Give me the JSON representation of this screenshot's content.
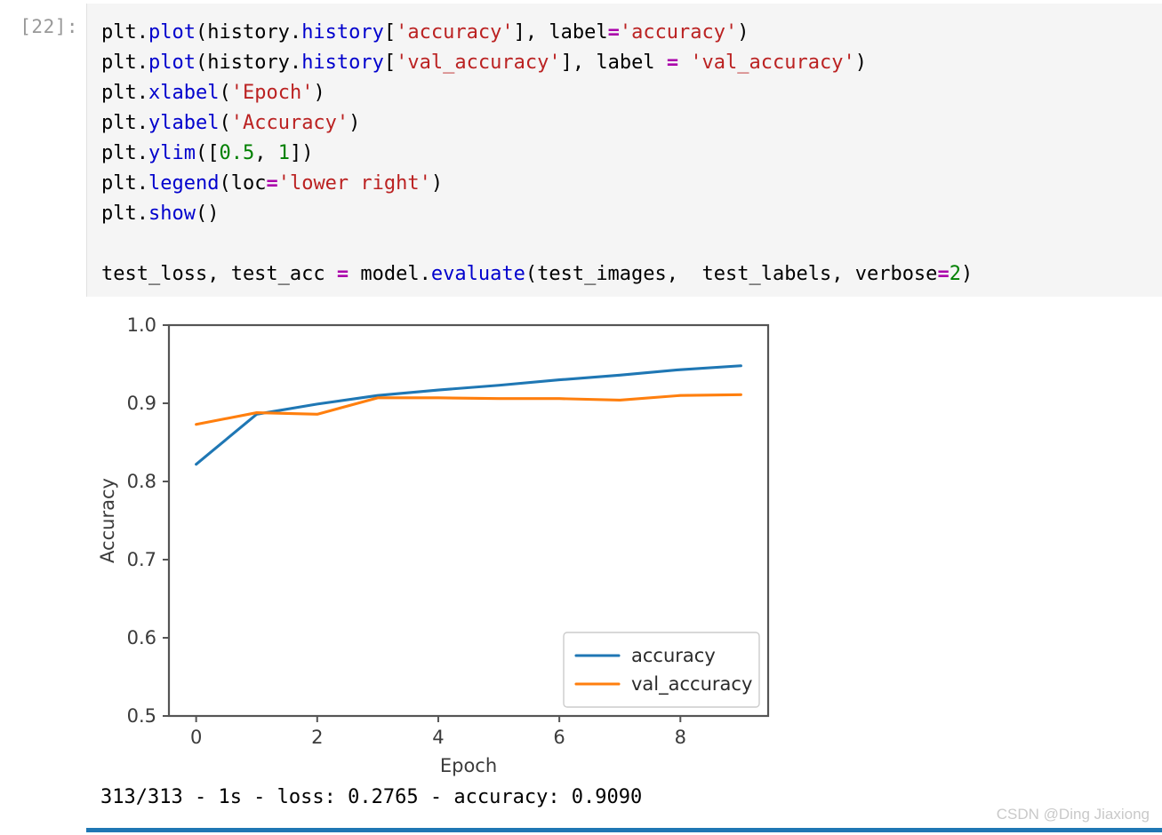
{
  "notebook": {
    "prompt_label": "[22]:",
    "code_lines": [
      [
        {
          "t": "plt.",
          "c": "plain"
        },
        {
          "t": "plot",
          "c": "fn"
        },
        {
          "t": "(history.",
          "c": "plain"
        },
        {
          "t": "history",
          "c": "fn"
        },
        {
          "t": "[",
          "c": "plain"
        },
        {
          "t": "'accuracy'",
          "c": "str"
        },
        {
          "t": "], label",
          "c": "plain"
        },
        {
          "t": "=",
          "c": "op"
        },
        {
          "t": "'accuracy'",
          "c": "str"
        },
        {
          "t": ")",
          "c": "plain"
        }
      ],
      [
        {
          "t": "plt.",
          "c": "plain"
        },
        {
          "t": "plot",
          "c": "fn"
        },
        {
          "t": "(history.",
          "c": "plain"
        },
        {
          "t": "history",
          "c": "fn"
        },
        {
          "t": "[",
          "c": "plain"
        },
        {
          "t": "'val_accuracy'",
          "c": "str"
        },
        {
          "t": "], label ",
          "c": "plain"
        },
        {
          "t": "=",
          "c": "op"
        },
        {
          "t": " ",
          "c": "plain"
        },
        {
          "t": "'val_accuracy'",
          "c": "str"
        },
        {
          "t": ")",
          "c": "plain"
        }
      ],
      [
        {
          "t": "plt.",
          "c": "plain"
        },
        {
          "t": "xlabel",
          "c": "fn"
        },
        {
          "t": "(",
          "c": "plain"
        },
        {
          "t": "'Epoch'",
          "c": "str"
        },
        {
          "t": ")",
          "c": "plain"
        }
      ],
      [
        {
          "t": "plt.",
          "c": "plain"
        },
        {
          "t": "ylabel",
          "c": "fn"
        },
        {
          "t": "(",
          "c": "plain"
        },
        {
          "t": "'Accuracy'",
          "c": "str"
        },
        {
          "t": ")",
          "c": "plain"
        }
      ],
      [
        {
          "t": "plt.",
          "c": "plain"
        },
        {
          "t": "ylim",
          "c": "fn"
        },
        {
          "t": "([",
          "c": "plain"
        },
        {
          "t": "0.5",
          "c": "num"
        },
        {
          "t": ", ",
          "c": "plain"
        },
        {
          "t": "1",
          "c": "num"
        },
        {
          "t": "])",
          "c": "plain"
        }
      ],
      [
        {
          "t": "plt.",
          "c": "plain"
        },
        {
          "t": "legend",
          "c": "fn"
        },
        {
          "t": "(loc",
          "c": "plain"
        },
        {
          "t": "=",
          "c": "op"
        },
        {
          "t": "'lower right'",
          "c": "str"
        },
        {
          "t": ")",
          "c": "plain"
        }
      ],
      [
        {
          "t": "plt.",
          "c": "plain"
        },
        {
          "t": "show",
          "c": "fn"
        },
        {
          "t": "()",
          "c": "plain"
        }
      ],
      [],
      [
        {
          "t": "test_loss, test_acc ",
          "c": "plain"
        },
        {
          "t": "=",
          "c": "op"
        },
        {
          "t": " model.",
          "c": "plain"
        },
        {
          "t": "evaluate",
          "c": "fn"
        },
        {
          "t": "(test_images,  test_labels, verbose",
          "c": "plain"
        },
        {
          "t": "=",
          "c": "op"
        },
        {
          "t": "2",
          "c": "num"
        },
        {
          "t": ")",
          "c": "plain"
        }
      ]
    ],
    "stdout_text": "313/313 - 1s - loss: 0.2765 - accuracy: 0.9090",
    "watermark_text": "CSDN @Ding Jiaxiong"
  },
  "chart_data": {
    "type": "line",
    "title": "",
    "xlabel": "Epoch",
    "ylabel": "Accuracy",
    "xlim": [
      -0.45,
      9.45
    ],
    "ylim": [
      0.5,
      1.0
    ],
    "xticks": [
      0,
      2,
      4,
      6,
      8
    ],
    "xticklabels": [
      "0",
      "2",
      "4",
      "6",
      "8"
    ],
    "yticks": [
      0.5,
      0.6,
      0.7,
      0.8,
      0.9,
      1.0
    ],
    "yticklabels": [
      "0.5",
      "0.6",
      "0.7",
      "0.8",
      "0.9",
      "1.0"
    ],
    "grid": false,
    "legend_position": "lower right",
    "x": [
      0,
      1,
      2,
      3,
      4,
      5,
      6,
      7,
      8,
      9
    ],
    "series": [
      {
        "name": "accuracy",
        "color": "#1f77b4",
        "values": [
          0.822,
          0.886,
          0.899,
          0.91,
          0.917,
          0.923,
          0.93,
          0.936,
          0.943,
          0.948
        ]
      },
      {
        "name": "val_accuracy",
        "color": "#ff7f0e",
        "values": [
          0.873,
          0.888,
          0.886,
          0.907,
          0.907,
          0.906,
          0.906,
          0.904,
          0.91,
          0.911
        ]
      }
    ]
  },
  "colors": {
    "accuracy_line": "#1f77b4",
    "val_accuracy_line": "#ff7f0e",
    "code_background": "#f5f5f5",
    "prompt": "#999999",
    "accent_bar": "#1f77b4",
    "watermark": "#c9c9c9"
  }
}
